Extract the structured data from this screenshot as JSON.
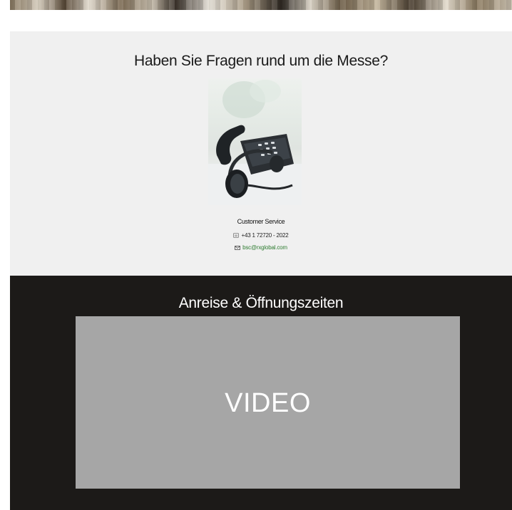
{
  "contact_section": {
    "title": "Haben Sie Fragen rund um die Messe?",
    "image_icon": "headset-phone-photo",
    "service_label": "Customer Service",
    "phone": "+43 1 72720 - 2022",
    "phone_icon": "phone-icon",
    "email": "bsc@rxglobal.com",
    "email_icon": "mail-icon",
    "email_color": "#2f7d32"
  },
  "travel_section": {
    "title": "Anreise & Öffnungszeiten",
    "video_placeholder": "VIDEO",
    "background_color": "#1c1a18",
    "video_color": "#a6a6a6"
  }
}
